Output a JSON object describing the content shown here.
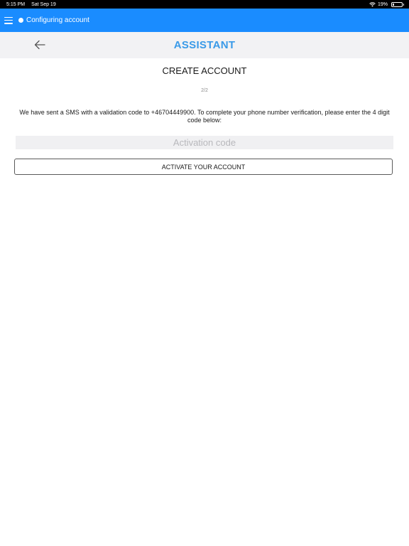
{
  "status_bar": {
    "time": "5:15 PM",
    "date": "Sat Sep 19",
    "battery": "19%",
    "battery_level": 0.19,
    "icons": [
      "wifi-icon",
      "battery-icon"
    ]
  },
  "top_bar": {
    "menu_icon": "menu-icon",
    "status_text": "Configuring account",
    "color": "#1a8cff"
  },
  "assistant_bar": {
    "back_icon": "arrow-left-icon",
    "title": "ASSISTANT",
    "title_color": "#3a9ae8"
  },
  "main": {
    "title": "CREATE ACCOUNT",
    "step": "2/2",
    "message": "We have sent a SMS with a validation code to +46704449900. To complete your phone number verification, please enter the 4 digit code below:",
    "code_input": {
      "value": "",
      "placeholder": "Activation code"
    },
    "activate_label": "ACTIVATE YOUR ACCOUNT"
  }
}
